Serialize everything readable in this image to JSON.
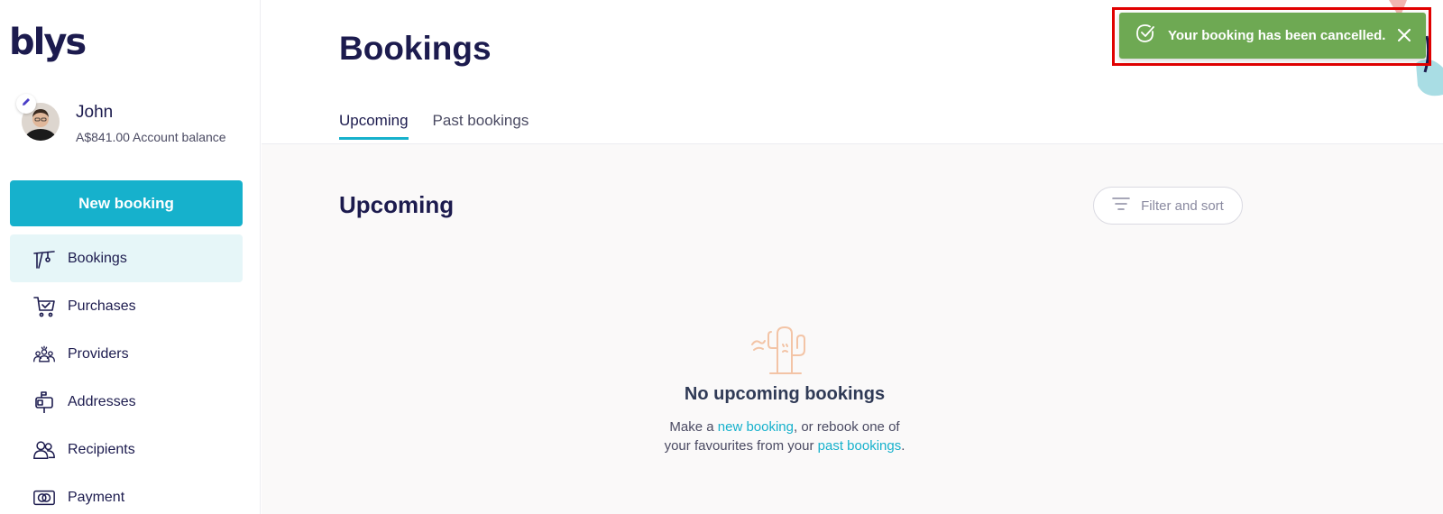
{
  "brand": {
    "logo_text": "blys"
  },
  "profile": {
    "name": "John",
    "balance": "A$841.00 Account balance"
  },
  "sidebar": {
    "new_booking_label": "New booking",
    "items": [
      {
        "label": "Bookings",
        "icon": "bookings-icon",
        "active": true
      },
      {
        "label": "Purchases",
        "icon": "cart-icon"
      },
      {
        "label": "Providers",
        "icon": "providers-icon"
      },
      {
        "label": "Addresses",
        "icon": "mailbox-icon"
      },
      {
        "label": "Recipients",
        "icon": "recipients-icon"
      },
      {
        "label": "Payment",
        "icon": "payment-icon"
      }
    ]
  },
  "header": {
    "title": "Bookings",
    "tabs": [
      {
        "label": "Upcoming",
        "active": true
      },
      {
        "label": "Past bookings"
      }
    ]
  },
  "content": {
    "section_title": "Upcoming",
    "filter_label": "Filter and sort",
    "empty_state": {
      "title": "No upcoming bookings",
      "line1_prefix": "Make a ",
      "line1_link": "new booking",
      "line1_suffix": ", or rebook one of",
      "line2_prefix": "your favourites from your ",
      "line2_link": "past bookings",
      "line2_suffix": "."
    }
  },
  "toast": {
    "message": "Your booking has been cancelled.",
    "icon": "check-circle-icon"
  },
  "colors": {
    "accent": "#16b1cc",
    "toast_success": "#6ea953",
    "navy": "#1c1b4e",
    "empty_icon": "#f3c4a6"
  }
}
